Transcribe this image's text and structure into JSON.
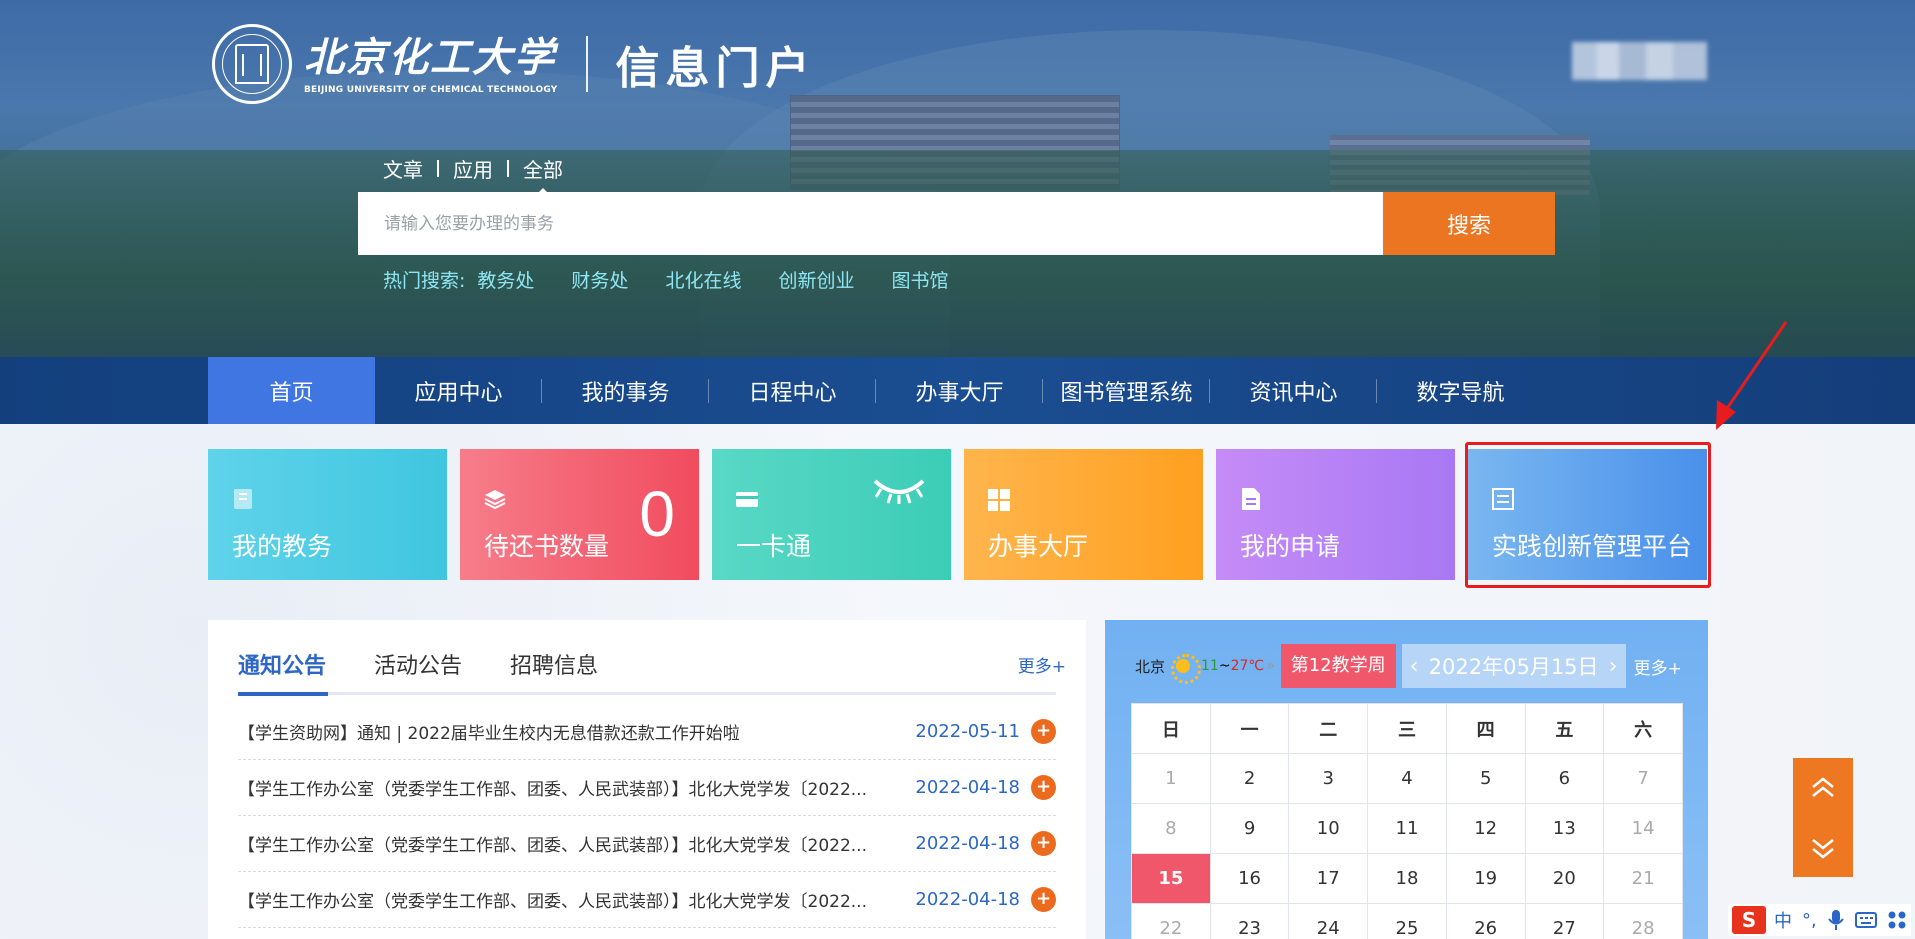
{
  "header": {
    "logo_cn": "北京化工大学",
    "logo_en": "BEIJING UNIVERSITY OF CHEMICAL TECHNOLOGY",
    "portal_title": "信息门户"
  },
  "search": {
    "tabs": [
      "文章",
      "应用",
      "全部"
    ],
    "placeholder": "请输入您要办理的事务",
    "button": "搜索",
    "hot_label": "热门搜索:",
    "hot_items": [
      "教务处",
      "财务处",
      "北化在线",
      "创新创业",
      "图书馆"
    ]
  },
  "nav": {
    "items": [
      "首页",
      "应用中心",
      "我的事务",
      "日程中心",
      "办事大厅",
      "图书管理系统",
      "资讯中心",
      "数字导航"
    ]
  },
  "cards": [
    {
      "label": "我的教务"
    },
    {
      "label": "待还书数量",
      "count": "0"
    },
    {
      "label": "一卡通"
    },
    {
      "label": "办事大厅"
    },
    {
      "label": "我的申请"
    },
    {
      "label": "实践创新管理平台"
    }
  ],
  "notices": {
    "tabs": [
      "通知公告",
      "活动公告",
      "招聘信息"
    ],
    "more": "更多+",
    "items": [
      {
        "title": "【学生资助网】通知 | 2022届毕业生校内无息借款还款工作开始啦",
        "date": "2022-05-11"
      },
      {
        "title": "【学生工作办公室（党委学生工作部、团委、人民武装部）】北化大党学发〔2022...",
        "date": "2022-04-18"
      },
      {
        "title": "【学生工作办公室（党委学生工作部、团委、人民武装部）】北化大党学发〔2022...",
        "date": "2022-04-18"
      },
      {
        "title": "【学生工作办公室（党委学生工作部、团委、人民武装部）】北化大党学发〔2022...",
        "date": "2022-04-18"
      }
    ],
    "plus": "+"
  },
  "calendar": {
    "city": "北京",
    "weather_icon": "sun-icon",
    "temp_low": "11",
    "temp_sep": "~",
    "temp_high": "27℃",
    "week_label": "第12教学周",
    "date": "2022年05月15日",
    "more": "更多+",
    "weekdays": [
      "日",
      "一",
      "二",
      "三",
      "四",
      "五",
      "六"
    ],
    "rows": [
      [
        "1",
        "2",
        "3",
        "4",
        "5",
        "6",
        "7"
      ],
      [
        "8",
        "9",
        "10",
        "11",
        "12",
        "13",
        "14"
      ],
      [
        "15",
        "16",
        "17",
        "18",
        "19",
        "20",
        "21"
      ],
      [
        "22",
        "23",
        "24",
        "25",
        "26",
        "27",
        "28"
      ]
    ],
    "today": "15"
  },
  "ime": {
    "logo": "S",
    "items": [
      "中",
      "°,"
    ]
  },
  "colors": {
    "accent": "#3f76e2",
    "search_button": "#ec7521",
    "annotation": "#e81c1c"
  }
}
